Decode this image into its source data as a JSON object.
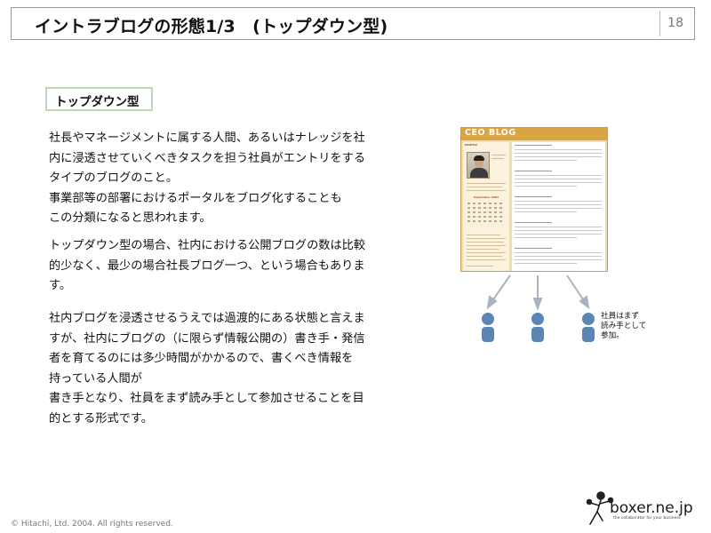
{
  "header": {
    "title": "イントラブログの形態1/3　(トップダウン型)",
    "page_number": "18"
  },
  "section_label": "トップダウン型",
  "paragraphs": [
    [
      "社長やマネージメントに属する人間、あるいはナレッジを社",
      "内に浸透させていくべきタスクを担う社員がエントリをする",
      "タイプのブログのこと。",
      "事業部等の部署におけるポータルをブログ化することも",
      "この分類になると思われます。"
    ],
    [
      "トップダウン型の場合、社内における公開ブログの数は比較",
      "的少なく、最少の場合社長ブログ一つ、という場合もありま",
      "す。"
    ],
    [
      "社内ブログを浸透させるうえでは過渡的にある状態と言えま",
      "すが、社内にブログの（に限らず情報公開の）書き手・発信",
      "者を育てるのには多少時間がかかるので、書くべき情報を",
      "持っている人間が",
      "書き手となり、社員をまず読み手として参加させることを目",
      "的とする形式です。"
    ]
  ],
  "blog_mock": {
    "title": "CEO BLOG",
    "profile_label": "PROFILE",
    "calendar_title": "September 2004"
  },
  "diagram_note": [
    "社員はまず",
    "読み手として",
    "参加。"
  ],
  "footer": {
    "copyright": "© Hitachi, Ltd. 2004. All rights reserved.",
    "logo_text": "boxer.ne.jp",
    "logo_tagline": "the collaborator for your business"
  },
  "colors": {
    "label_border": "#b9dcae",
    "blog_header": "#d9a441",
    "person": "#5b86b3",
    "arrow": "#a8b4bf"
  }
}
